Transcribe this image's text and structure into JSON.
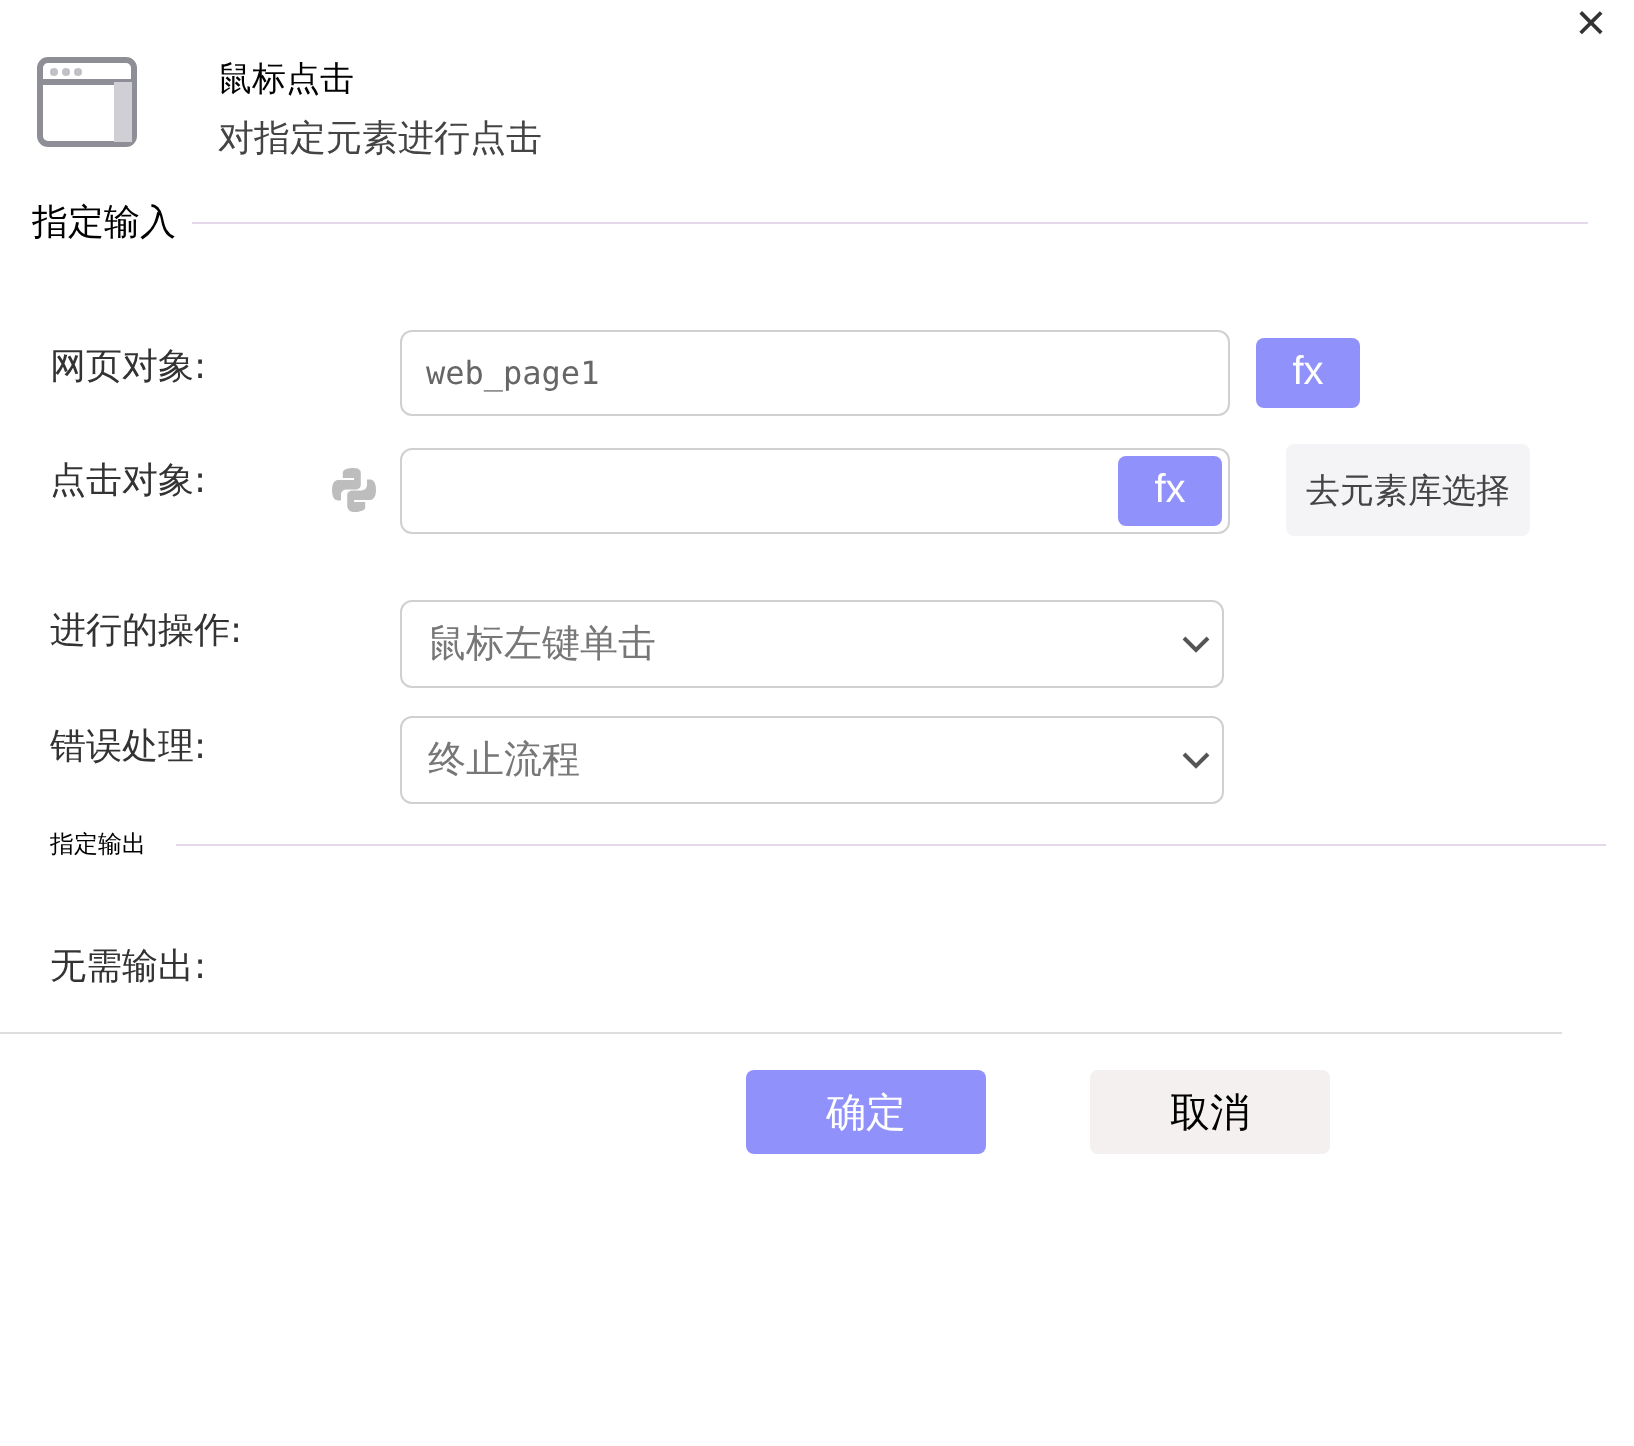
{
  "header": {
    "title": "鼠标点击",
    "subtitle": "对指定元素进行点击",
    "close": "×"
  },
  "input_section": {
    "title": "指定输入",
    "fields": [
      {
        "kind": "text",
        "label": "网页对象:",
        "value": "web_page1",
        "fx": "fx"
      },
      {
        "kind": "element",
        "label": "点击对象:",
        "fx": "fx",
        "pick_button": "去元素库选择"
      },
      {
        "kind": "select",
        "label": "进行的操作:",
        "value": "鼠标左键单击"
      },
      {
        "kind": "select",
        "label": "错误处理:",
        "value": "终止流程"
      }
    ]
  },
  "output_section": {
    "title": "指定输出",
    "label": "无需输出:"
  },
  "buttons": [
    {
      "kind": "primary",
      "label": "确定"
    },
    {
      "kind": "secondary",
      "label": "取消"
    }
  ]
}
